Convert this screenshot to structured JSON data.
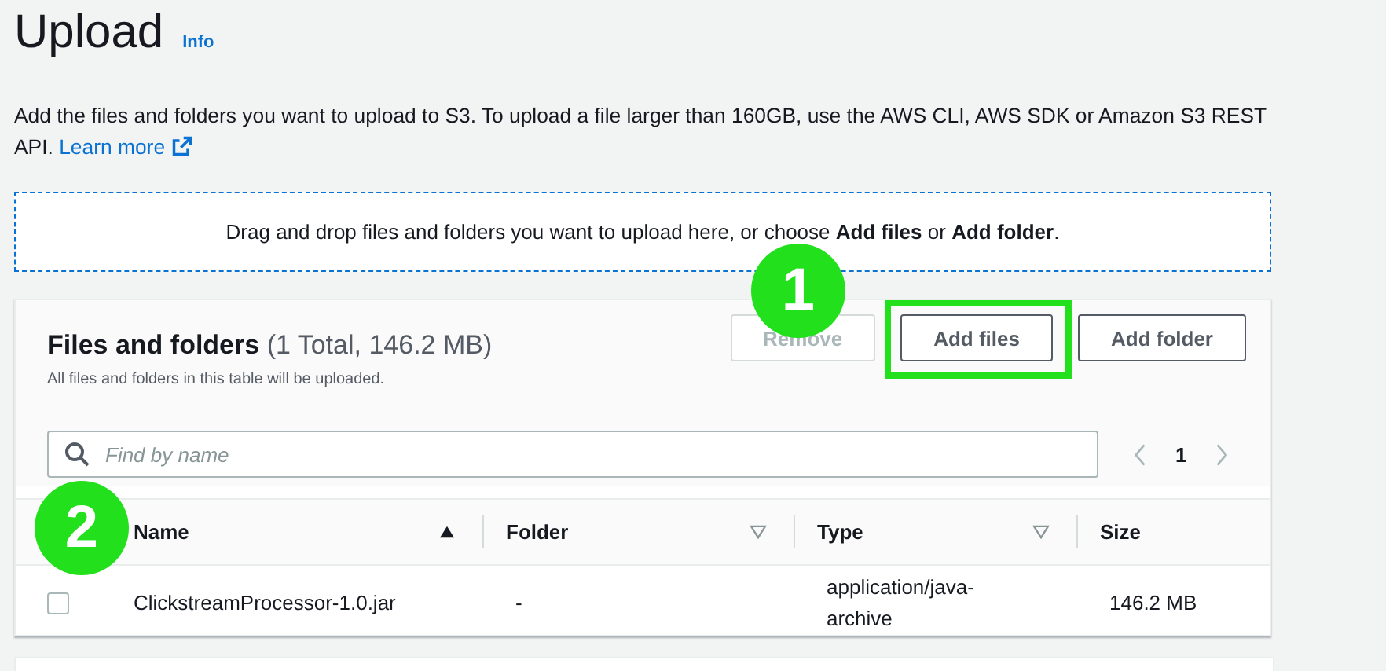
{
  "header": {
    "title": "Upload",
    "info_link": "Info"
  },
  "description": {
    "text": "Add the files and folders you want to upload to S3. To upload a file larger than 160GB, use the AWS CLI, AWS SDK or Amazon S3 REST API.",
    "link": "Learn more"
  },
  "dropzone": {
    "text": "Drag and drop files and folders you want to upload here, or choose **Add files** or **Add folder**."
  },
  "files_panel": {
    "title": "Files and folders",
    "count": "(1 Total, 146.2 MB)",
    "subtitle": "All files and folders in this table will be uploaded.",
    "buttons": [
      {
        "label": "Remove",
        "disabled": true,
        "highlighted": false
      },
      {
        "label": "Add files",
        "disabled": false,
        "highlighted": true
      },
      {
        "label": "Add folder",
        "disabled": false,
        "highlighted": false
      }
    ],
    "search": {
      "placeholder": "Find by name"
    },
    "pagination": {
      "page": "1"
    },
    "table": {
      "columns": [
        {
          "label": "Name",
          "sorted": true
        },
        {
          "label": "Folder",
          "sorted": false
        },
        {
          "label": "Type",
          "sorted": false
        },
        {
          "label": "Size"
        }
      ],
      "rows": [
        {
          "checked": false,
          "cells": [
            "ClickstreamProcessor-1.0.jar",
            "-",
            "application/java-archive",
            "146.2 MB"
          ]
        }
      ]
    }
  },
  "annotations": [
    {
      "label": "1"
    },
    {
      "label": "2"
    }
  ]
}
